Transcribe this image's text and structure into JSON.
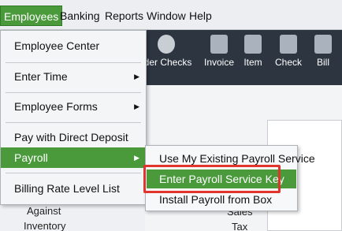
{
  "menubar": {
    "items": [
      {
        "label": "Employees",
        "active": true
      },
      {
        "label": "Banking"
      },
      {
        "label": "Reports"
      },
      {
        "label": "Window"
      },
      {
        "label": "Help"
      }
    ]
  },
  "toolbar": {
    "items": [
      {
        "label": "rder Checks",
        "icon": "order-checks-icon"
      },
      {
        "label": "Invoice",
        "icon": "invoice-icon"
      },
      {
        "label": "Item",
        "icon": "item-icon"
      },
      {
        "label": "Check",
        "icon": "check-icon"
      },
      {
        "label": "Bill",
        "icon": "bill-icon"
      }
    ]
  },
  "dropdown": {
    "items": [
      "Employee Center",
      "Enter Time",
      "Employee Forms",
      "Pay with Direct Deposit",
      "Payroll",
      "Billing Rate Level List"
    ]
  },
  "submenu": {
    "items": [
      "Use My Existing Payroll Service",
      "Enter Payroll Service Key",
      "Install Payroll from Box"
    ]
  },
  "background": {
    "against": "Against",
    "inventory": "Inventory",
    "sales": "Sales",
    "tax": "Tax"
  },
  "colors": {
    "accent": "#4a9a3c",
    "highlight_box": "#e0342c",
    "toolbar_bg": "#2c3540"
  }
}
